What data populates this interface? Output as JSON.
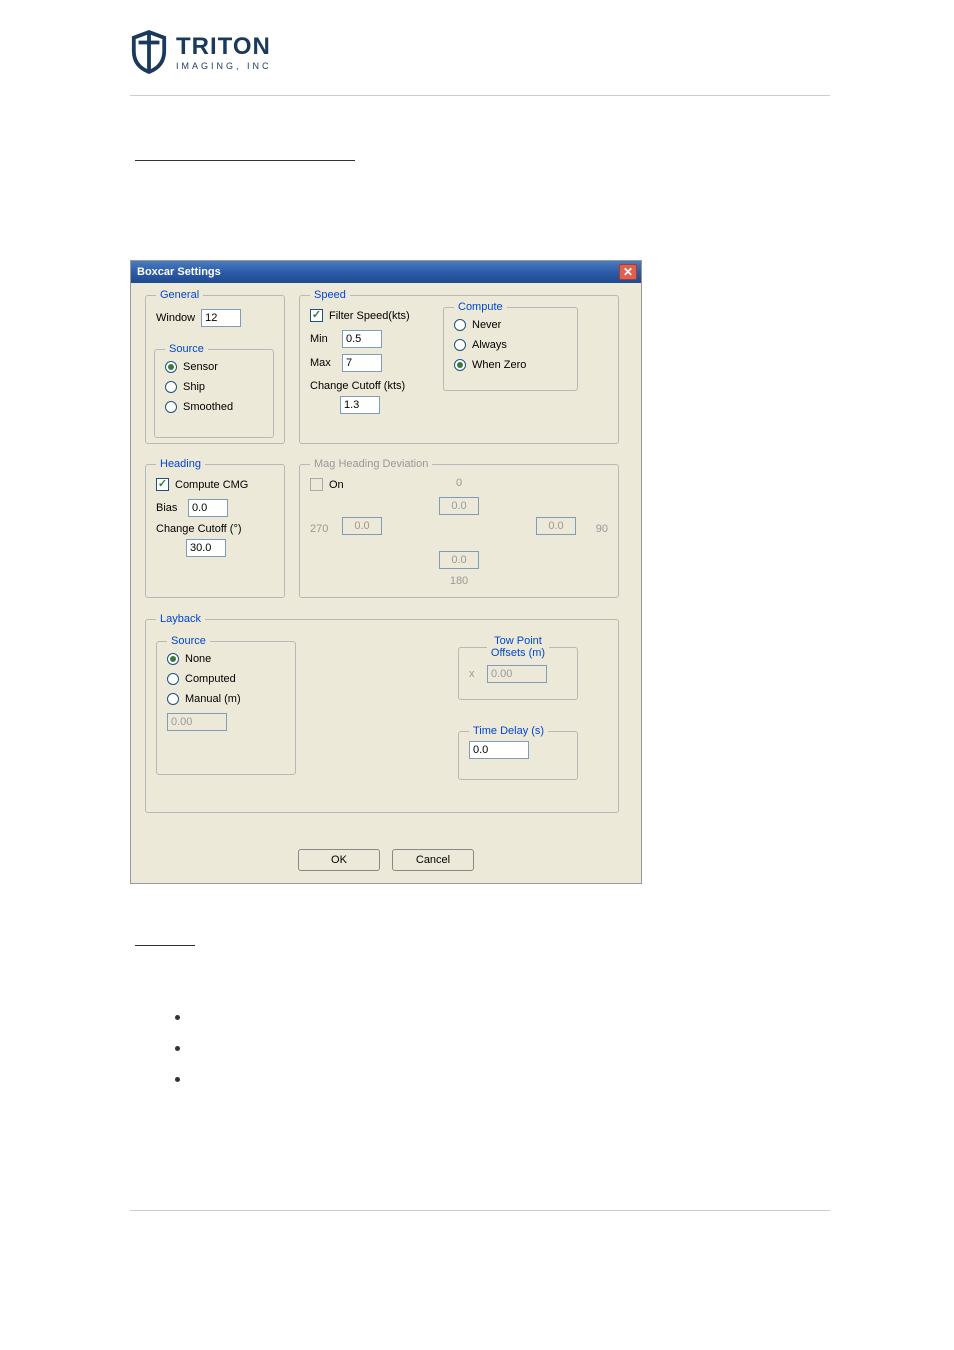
{
  "logo": {
    "main": "TRITON",
    "sub": "IMAGING, INC"
  },
  "dialog": {
    "title": "Boxcar Settings",
    "general": {
      "legend": "General",
      "window_label": "Window",
      "window_value": "12",
      "source": {
        "legend": "Source",
        "options": [
          "Sensor",
          "Ship",
          "Smoothed"
        ],
        "selected": "Sensor"
      }
    },
    "speed": {
      "legend": "Speed",
      "filter_label": "Filter Speed(kts)",
      "filter_checked": true,
      "min_label": "Min",
      "min_value": "0.5",
      "max_label": "Max",
      "max_value": "7",
      "change_cutoff_label": "Change Cutoff (kts)",
      "change_cutoff_value": "1.3",
      "compute": {
        "legend": "Compute",
        "options": [
          "Never",
          "Always",
          "When Zero"
        ],
        "selected": "When Zero"
      }
    },
    "heading": {
      "legend": "Heading",
      "compute_cmg_label": "Compute CMG",
      "compute_cmg_checked": true,
      "bias_label": "Bias",
      "bias_value": "0.0",
      "change_cutoff_label": "Change Cutoff (°)",
      "change_cutoff_value": "30.0"
    },
    "mag": {
      "legend": "Mag Heading Deviation",
      "on_label": "On",
      "on_checked": false,
      "top": "0",
      "top_val": "0.0",
      "left": "270",
      "left_val": "0.0",
      "right": "90",
      "right_val": "0.0",
      "bottom": "180",
      "bottom_val": "0.0"
    },
    "layback": {
      "legend": "Layback",
      "source": {
        "legend": "Source",
        "options": [
          "None",
          "Computed",
          "Manual (m)"
        ],
        "selected": "None",
        "manual_value": "0.00"
      },
      "towpoint": {
        "legend1": "Tow Point",
        "legend2": "Offsets (m)",
        "x_label": "x",
        "x_value": "0.00"
      },
      "timedelay": {
        "legend": "Time Delay (s)",
        "value": "0.0"
      }
    },
    "buttons": {
      "ok": "OK",
      "cancel": "Cancel"
    }
  }
}
